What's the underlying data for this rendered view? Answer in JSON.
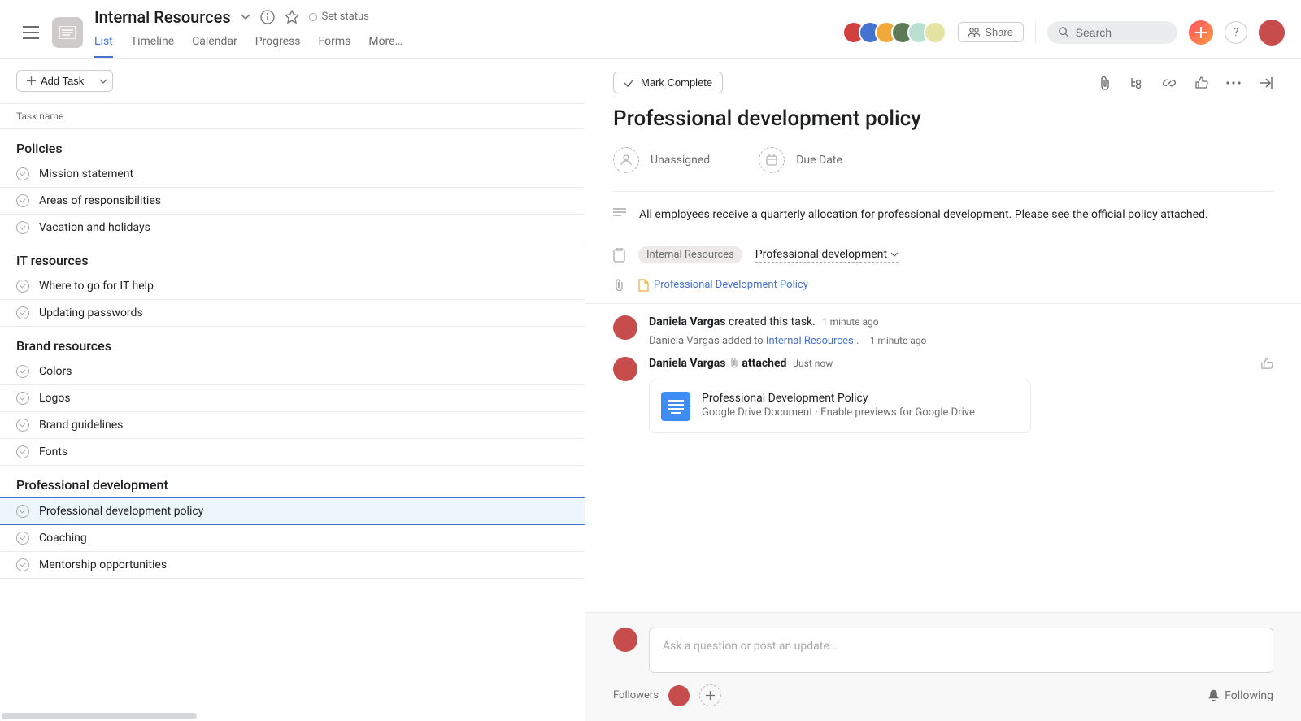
{
  "header": {
    "project_title": "Internal Resources",
    "set_status": "Set status",
    "share": "Share",
    "search_placeholder": "Search",
    "tabs": [
      "List",
      "Timeline",
      "Calendar",
      "Progress",
      "Forms",
      "More…"
    ],
    "avatar_colors": [
      "#d24040",
      "#4573d2",
      "#f2a93b",
      "#5c7a55",
      "#b8e0d0",
      "#e3e3a3"
    ]
  },
  "list": {
    "add_task": "Add Task",
    "col_header": "Task name",
    "sections": [
      {
        "name": "Policies",
        "tasks": [
          "Mission statement",
          "Areas of responsibilities",
          "Vacation and holidays"
        ]
      },
      {
        "name": "IT resources",
        "tasks": [
          "Where to go for IT help",
          "Updating passwords"
        ]
      },
      {
        "name": "Brand resources",
        "tasks": [
          "Colors",
          "Logos",
          "Brand guidelines",
          "Fonts"
        ]
      },
      {
        "name": "Professional development",
        "tasks": [
          "Professional development policy",
          "Coaching",
          "Mentorship opportunities"
        ]
      }
    ],
    "selected": "Professional development policy"
  },
  "detail": {
    "mark_complete": "Mark Complete",
    "title": "Professional development policy",
    "unassigned": "Unassigned",
    "due_date": "Due Date",
    "description": "All employees receive a quarterly allocation for professional development. Please see the official policy attached.",
    "project_chip": "Internal Resources",
    "project_section": "Professional development",
    "file_link": "Professional Development Policy",
    "activity": {
      "creator": "Daniela Vargas",
      "created_text": "created this task.",
      "created_time": "1 minute ago",
      "added_prefix": "Daniela Vargas",
      "added_text": "added to",
      "added_target": "Internal Resources",
      "added_suffix": ".",
      "added_time": "1 minute ago",
      "attach_user": "Daniela Vargas",
      "attach_verb": "attached",
      "attach_time": "Just now",
      "attachment_title": "Professional Development Policy",
      "attachment_sub": "Google Drive Document · Enable previews for Google Drive"
    },
    "comment_placeholder": "Ask a question or post an update…",
    "followers_label": "Followers",
    "following_label": "Following"
  }
}
